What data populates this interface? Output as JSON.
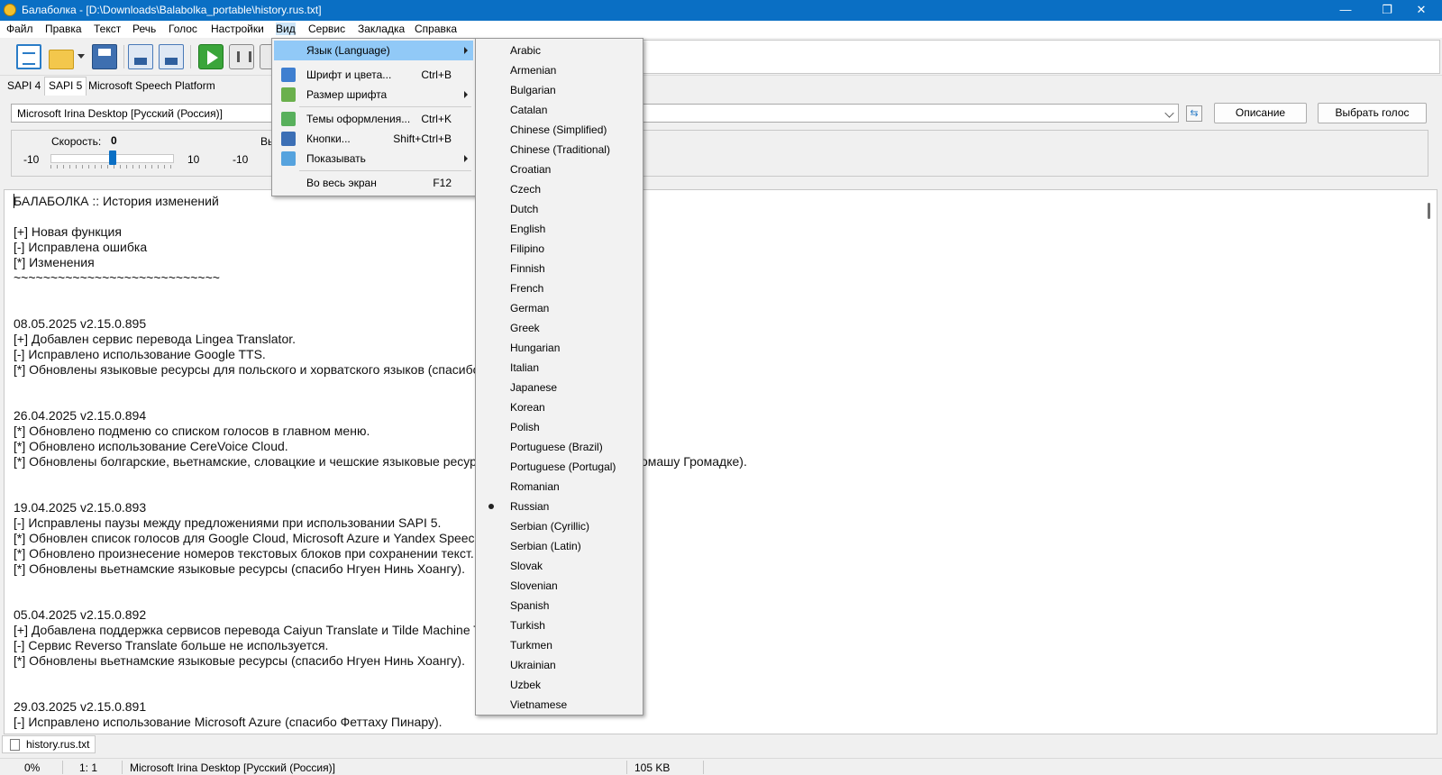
{
  "window": {
    "title": "Балаболка - [D:\\Downloads\\Balabolka_portable\\history.rus.txt]",
    "controls": {
      "minimize": "—",
      "maximize": "❐",
      "close": "✕"
    }
  },
  "menubar": [
    "Файл",
    "Правка",
    "Текст",
    "Речь",
    "Голос",
    "Настройки",
    "Вид",
    "Сервис",
    "Закладка",
    "Справка"
  ],
  "engine_tabs": [
    "SAPI 4",
    "SAPI 5",
    "Microsoft Speech Platform"
  ],
  "voice": {
    "selected": "Microsoft Irina Desktop [Русский (Россия)]",
    "description_button": "Описание",
    "choose_voice_button": "Выбрать голос"
  },
  "sliders": {
    "speed_label": "Скорость:",
    "speed_value": "0",
    "speed_min": "-10",
    "speed_max": "10",
    "second_min": "-10",
    "second_label_partial": "Вы"
  },
  "view_menu": {
    "items": [
      {
        "label": "Язык (Language)",
        "shortcut": "",
        "submenu": true,
        "icon": "",
        "highlighted": true
      },
      {
        "label": "Шрифт и цвета...",
        "shortcut": "Ctrl+B",
        "submenu": false,
        "icon": "font-color-icon"
      },
      {
        "label": "Размер шрифта",
        "shortcut": "",
        "submenu": true,
        "icon": "font-size-icon"
      },
      {
        "label": "Темы оформления...",
        "shortcut": "Ctrl+K",
        "submenu": false,
        "icon": "themes-icon"
      },
      {
        "label": "Кнопки...",
        "shortcut": "Shift+Ctrl+B",
        "submenu": false,
        "icon": "buttons-icon"
      },
      {
        "label": "Показывать",
        "shortcut": "",
        "submenu": true,
        "icon": "show-icon"
      },
      {
        "label": "Во весь экран",
        "shortcut": "F12",
        "submenu": false,
        "icon": ""
      }
    ]
  },
  "language_menu": {
    "items": [
      "Arabic",
      "Armenian",
      "Bulgarian",
      "Catalan",
      "Chinese (Simplified)",
      "Chinese (Traditional)",
      "Croatian",
      "Czech",
      "Dutch",
      "English",
      "Filipino",
      "Finnish",
      "French",
      "German",
      "Greek",
      "Hungarian",
      "Italian",
      "Japanese",
      "Korean",
      "Polish",
      "Portuguese (Brazil)",
      "Portuguese (Portugal)",
      "Romanian",
      "Russian",
      "Serbian (Cyrillic)",
      "Serbian (Latin)",
      "Slovak",
      "Slovenian",
      "Spanish",
      "Turkish",
      "Turkmen",
      "Ukrainian",
      "Uzbek",
      "Vietnamese"
    ],
    "selected": "Russian"
  },
  "editor": {
    "lines": [
      "БАЛАБОЛКА :: История изменений",
      "",
      "[+] Новая функция",
      "[-] Исправлена ошибка",
      "[*] Изменения",
      "~~~~~~~~~~~~~~~~~~~~~~~~~~~~",
      "",
      "",
      "08.05.2025    v2.15.0.895",
      "[+] Добавлен сервис перевода Lingea Translator.",
      "[-] Исправлено использование Google TTS.",
      "[*] Обновлены языковые ресурсы для польского и хорватского языков (спасибо ... у Дивичу).",
      "",
      "",
      "26.04.2025    v2.15.0.894",
      "[*] Обновлено подменю со списком голосов в главном меню.",
      "[*] Обновлено использование CereVoice Cloud.",
      "[*] Обновлены болгарские, вьетнамские, словацкие и чешские языковые ресур... ву, Нгуен Нинь Хоангу и Томашу Громадке).",
      "",
      "",
      "19.04.2025    v2.15.0.893",
      "[-] Исправлены паузы между предложениями при использовании SAPI 5.",
      "[*] Обновлен список голосов для Google Cloud, Microsoft Azure и Yandex SpeechK...",
      "[*] Обновлено произнесение номеров текстовых блоков при сохранении текст... ов.",
      "[*] Обновлены вьетнамские языковые ресурсы (спасибо Нгуен Нинь Хоангу).",
      "",
      "",
      "05.04.2025    v2.15.0.892",
      "[+] Добавлена поддержка сервисов перевода Caiyun Translate и Tilde Machine T...",
      "[-] Сервис Reverso Translate больше не используется.",
      "[*] Обновлены вьетнамские языковые ресурсы (спасибо Нгуен Нинь Хоангу).",
      "",
      "",
      "29.03.2025    v2.15.0.891",
      "[-] Исправлено использование Microsoft Azure (спасибо Феттаху Пинару)."
    ]
  },
  "document_tabs": [
    "history.rus.txt"
  ],
  "status": {
    "progress": "0%",
    "position": "1:   1",
    "voice": "Microsoft Irina Desktop [Русский (Россия)]",
    "size": "105 KB"
  }
}
